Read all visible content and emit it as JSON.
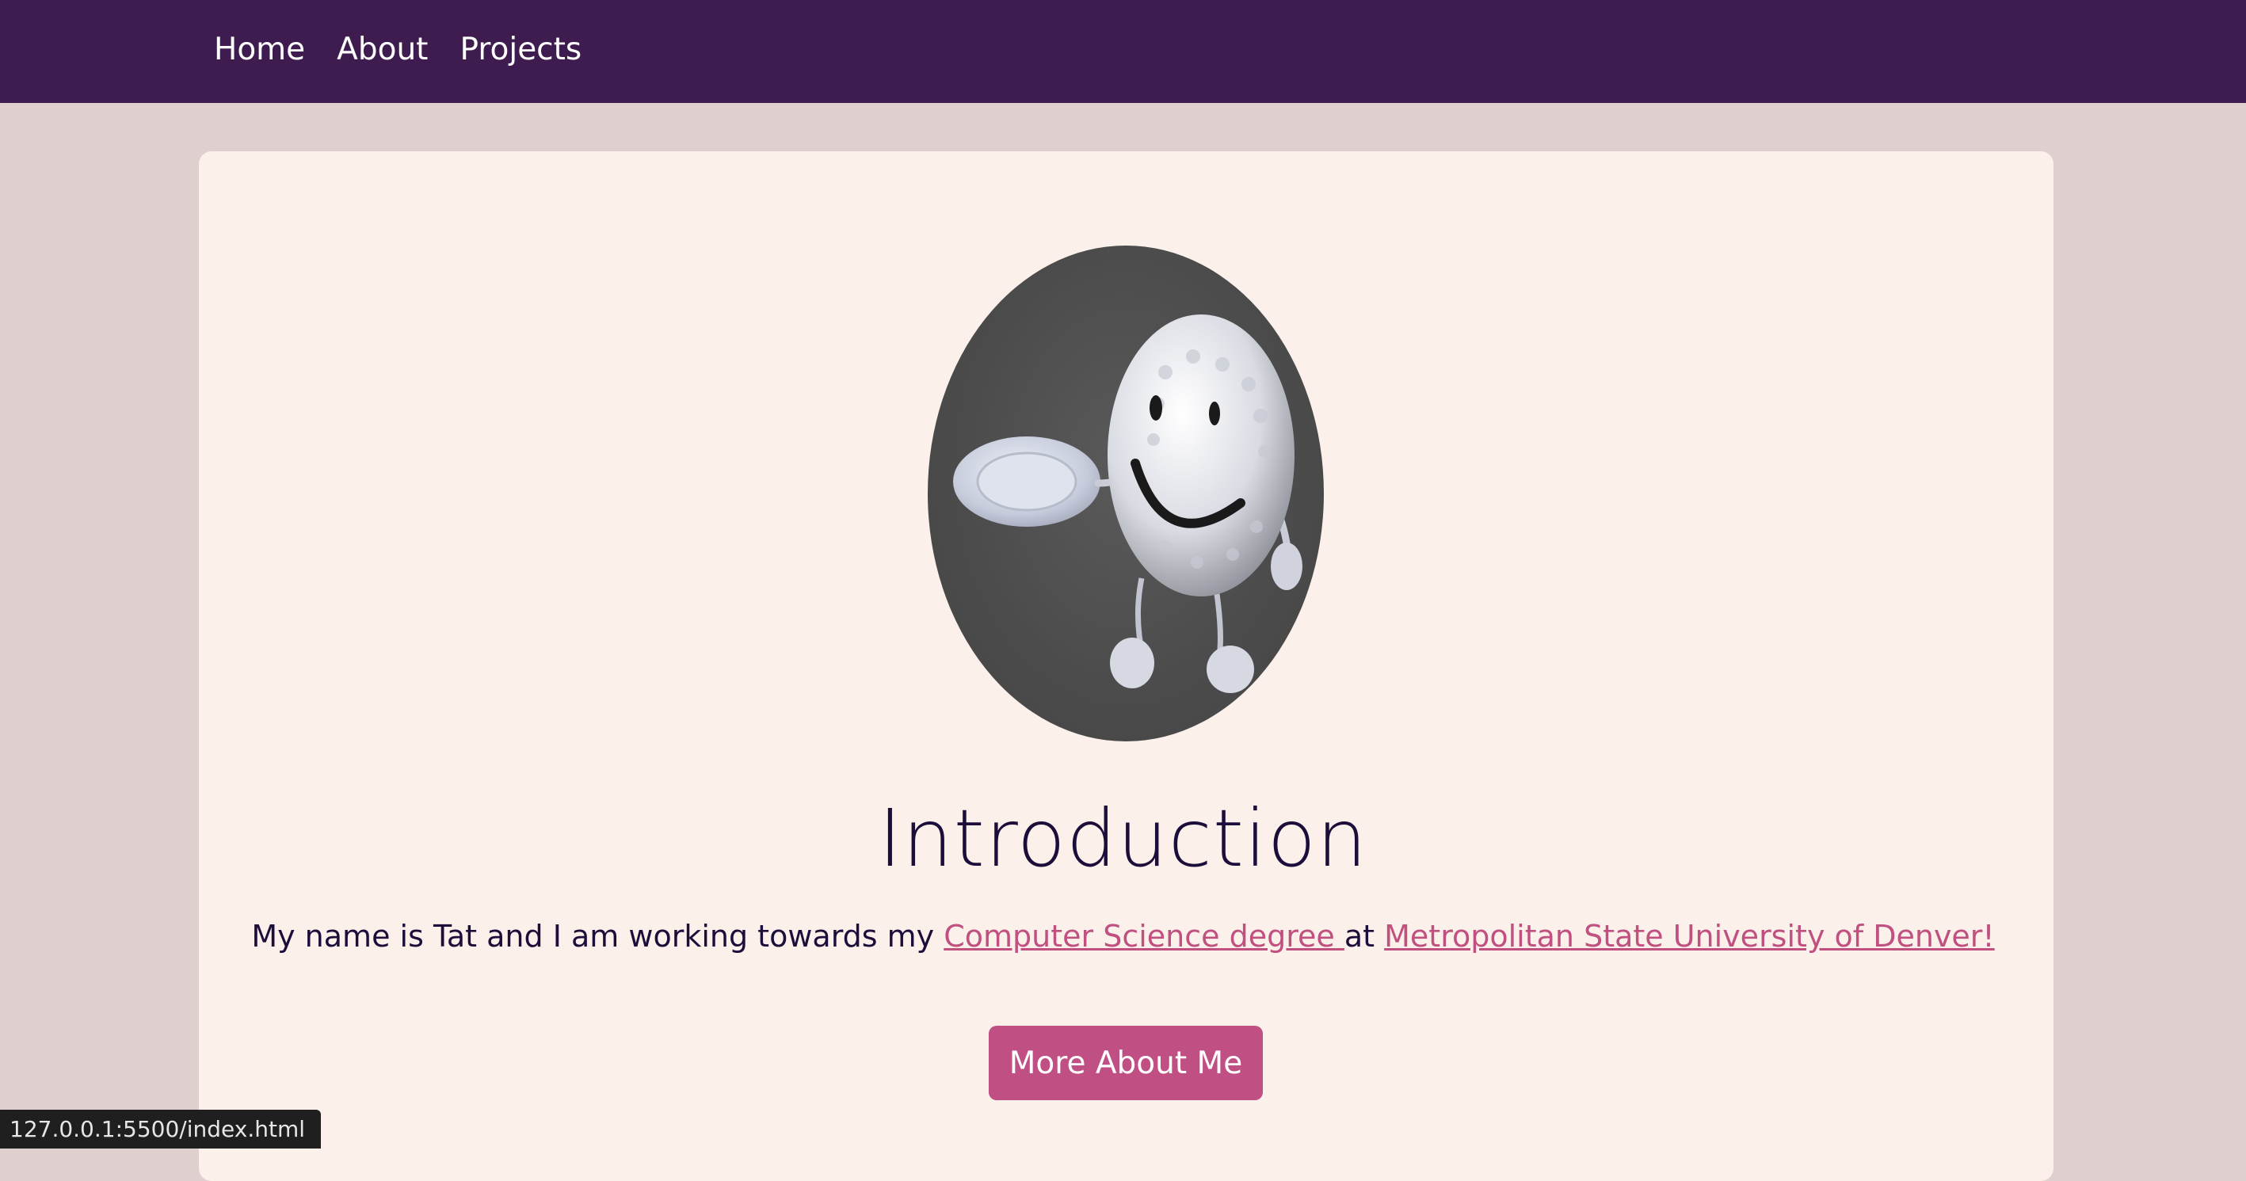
{
  "nav": {
    "items": [
      {
        "label": "Home"
      },
      {
        "label": "About"
      },
      {
        "label": "Projects"
      }
    ]
  },
  "main": {
    "avatar_alt": "golf-ball-character",
    "title": "Introduction",
    "intro_prefix": "My name is Tat and I am working towards my ",
    "link_degree": "Computer Science degree ",
    "intro_mid": "at ",
    "link_university": "Metropolitan State University of Denver!",
    "cta_label": "More About Me"
  },
  "status": {
    "url": "127.0.0.1:5500/index.html"
  },
  "colors": {
    "nav_bg": "#3f1c4f",
    "page_bg": "#e0cfcf",
    "card_bg": "#fbf1ea",
    "accent": "#c04f84",
    "text": "#1c0e3a"
  }
}
